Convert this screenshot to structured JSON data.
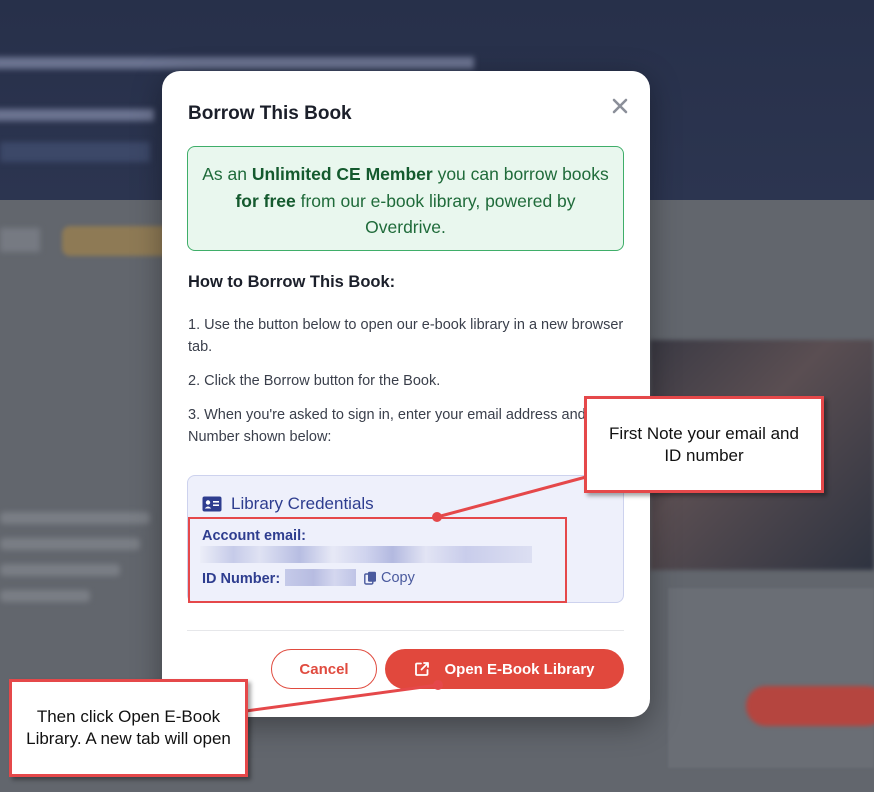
{
  "modal": {
    "title": "Borrow This Book",
    "info": {
      "prefix": "As an ",
      "member": "Unlimited CE Member",
      "middle": " you can borrow books ",
      "free": "for free",
      "suffix": " from our e-book library, powered by Overdrive."
    },
    "howto_title": "How to Borrow This Book:",
    "steps": [
      "1. Use the button below to open our e-book library in a new browser tab.",
      "2. Click the Borrow button for the Book.",
      "3. When you're asked to sign in, enter your email address and ID Number shown below:"
    ],
    "credentials": {
      "title": "Library Credentials",
      "email_label": "Account email:",
      "id_label": "ID Number:",
      "copy_label": "Copy"
    },
    "cancel_label": "Cancel",
    "open_label": "Open E-Book Library"
  },
  "annotations": {
    "note1": "First Note your email and ID number",
    "note2": "Then click Open E-Book Library. A new tab will open"
  },
  "colors": {
    "accent": "#e1483d",
    "callout_border": "#e5484a",
    "info_bg": "#e9f7ee",
    "info_border": "#3fae69",
    "credentials_text": "#2e3d8f"
  },
  "icons": {
    "close": "close-icon",
    "credentials": "id-card-icon",
    "copy": "copy-icon",
    "open": "external-link-icon"
  }
}
